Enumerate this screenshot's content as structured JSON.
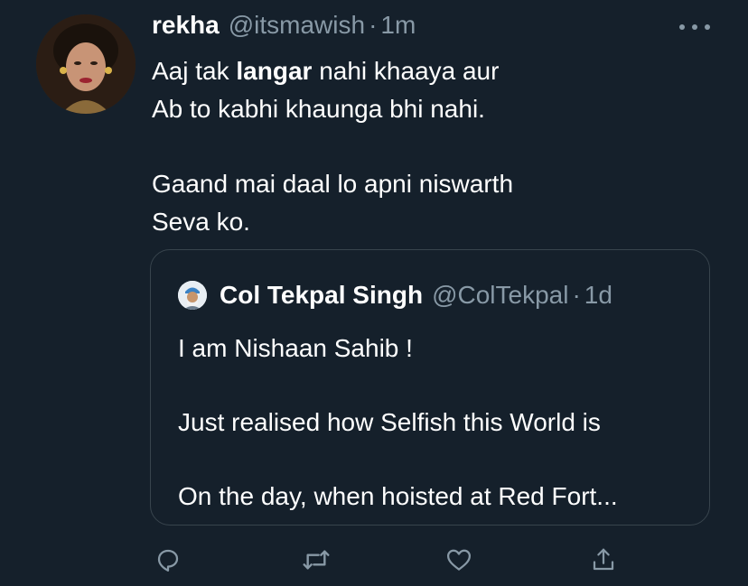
{
  "tweet": {
    "author_name": "rekha",
    "author_handle": "@itsmawish",
    "separator": "·",
    "time": "1m",
    "body": {
      "line1_pre": "Aaj tak ",
      "line1_bold": "langar",
      "line1_post": " nahi khaaya aur",
      "line2": "Ab to kabhi khaunga bhi nahi.",
      "line3": "Gaand mai daal lo apni niswarth",
      "line4": "Seva ko."
    }
  },
  "quoted_tweet": {
    "author_name": "Col Tekpal Singh",
    "author_handle": "@ColTekpal",
    "separator": "·",
    "time": "1d",
    "lines": [
      "I am Nishaan Sahib !",
      "Just realised how Selfish this World is",
      "On the day, when hoisted at Red Fort..."
    ]
  },
  "icons": {
    "more": "more-dots-icon",
    "reply": "reply-icon",
    "retweet": "retweet-icon",
    "like": "heart-icon",
    "share": "share-icon"
  },
  "colors": {
    "background": "#15202b",
    "secondary_text": "#8899a6",
    "border": "#38444d"
  }
}
